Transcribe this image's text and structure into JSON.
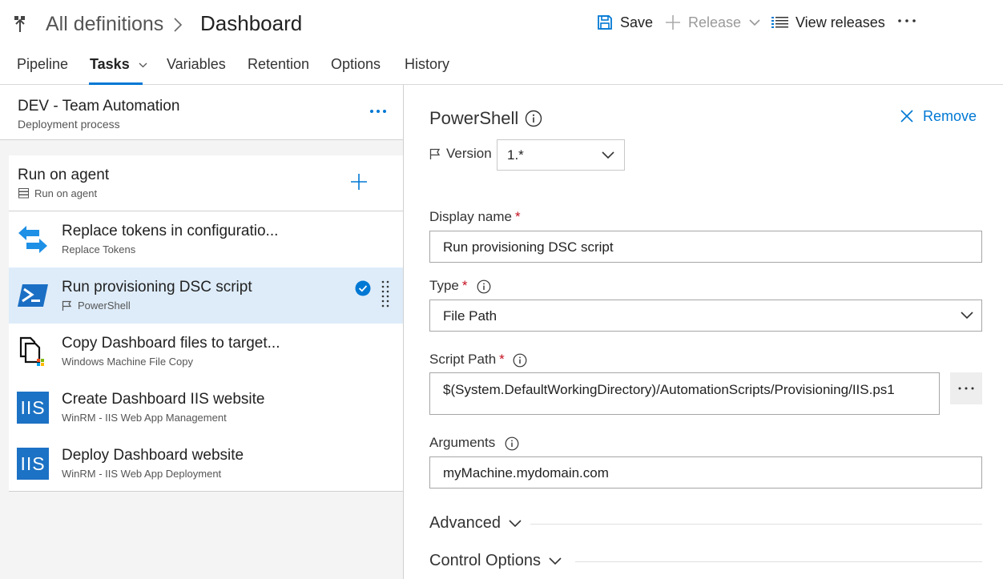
{
  "header": {
    "breadcrumb_root": "All definitions",
    "breadcrumb_current": "Dashboard",
    "toolbar": {
      "save_label": "Save",
      "release_label": "Release",
      "view_releases_label": "View releases"
    }
  },
  "tabs": [
    {
      "label": "Pipeline"
    },
    {
      "label": "Tasks"
    },
    {
      "label": "Variables"
    },
    {
      "label": "Retention"
    },
    {
      "label": "Options"
    },
    {
      "label": "History"
    }
  ],
  "environment": {
    "title": "DEV - Team Automation",
    "subtitle": "Deployment process"
  },
  "agent_job": {
    "title": "Run on agent",
    "subtitle": "Run on agent"
  },
  "tasks": [
    {
      "name": "Replace tokens in configuratio...",
      "type": "Replace Tokens",
      "icon": "replace-tokens-icon"
    },
    {
      "name": "Run provisioning DSC script",
      "type": "PowerShell",
      "icon": "powershell-icon",
      "selected": true
    },
    {
      "name": "Copy Dashboard files to target...",
      "type": "Windows Machine File Copy",
      "icon": "file-copy-icon"
    },
    {
      "name": "Create Dashboard IIS website",
      "type": "WinRM - IIS Web App Management",
      "icon": "iis-icon",
      "icon_text": "IIS"
    },
    {
      "name": "Deploy Dashboard website",
      "type": "WinRM - IIS Web App Deployment",
      "icon": "iis-icon",
      "icon_text": "IIS"
    }
  ],
  "task_detail": {
    "title": "PowerShell",
    "remove_label": "Remove",
    "version_label": "Version",
    "version_value": "1.*",
    "display_name_label": "Display name",
    "display_name_value": "Run provisioning DSC script",
    "type_label": "Type",
    "type_value": "File Path",
    "script_path_label": "Script Path",
    "script_path_value": "$(System.DefaultWorkingDirectory)/AutomationScripts/Provisioning/IIS.ps1",
    "arguments_label": "Arguments",
    "arguments_value": "myMachine.mydomain.com",
    "required_mark": "*",
    "advanced_label": "Advanced",
    "control_options_label": "Control Options"
  },
  "colors": {
    "accent": "#0078d4",
    "selected_row": "#deecf9",
    "required": "#c50f1f",
    "iis_tile": "#1c72c4"
  }
}
